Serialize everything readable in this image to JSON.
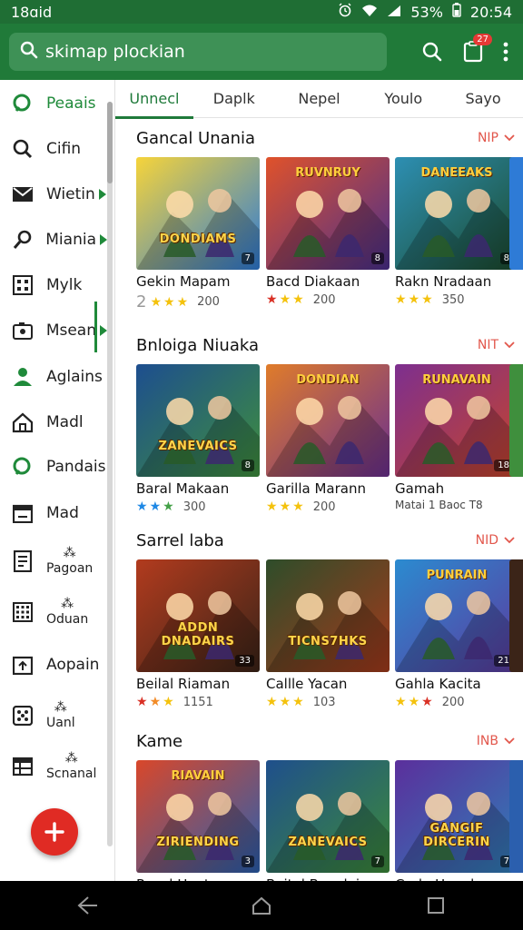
{
  "status_bar": {
    "left_text": "18ɑid",
    "battery": "53%",
    "time": "20:54"
  },
  "search": {
    "value": "skimap plockian",
    "cart_badge": "27"
  },
  "drawer": {
    "items": [
      {
        "label": "Peaais",
        "icon": "chat-bubble-icon",
        "active": true
      },
      {
        "label": "Cifin",
        "icon": "search-icon"
      },
      {
        "label": "Wietin",
        "icon": "mail-icon"
      },
      {
        "label": "Miania",
        "icon": "magnifier-icon"
      },
      {
        "label": "Mylk",
        "icon": "grid-icon"
      },
      {
        "label": "Msean",
        "icon": "camera-icon"
      },
      {
        "label": "Aglains",
        "icon": "person-icon"
      },
      {
        "label": "Madl",
        "icon": "home-icon"
      },
      {
        "label": "Pandais",
        "icon": "chat-bubble-icon"
      },
      {
        "label": "Mad",
        "icon": "calendar-icon"
      },
      {
        "label": "Pagoan",
        "icon": "document-icon",
        "top": "⁂"
      },
      {
        "label": "Oduan",
        "icon": "keypad-icon",
        "top": "⁂"
      },
      {
        "label": "Aopain",
        "icon": "upload-icon"
      },
      {
        "label": "Uanl",
        "icon": "dice-icon",
        "top": "⁂"
      },
      {
        "label": "Scnanal",
        "icon": "table-icon",
        "top": "⁂"
      }
    ]
  },
  "tabs": [
    {
      "label": "Unnecl",
      "active": true
    },
    {
      "label": "Daplk"
    },
    {
      "label": "Nepel"
    },
    {
      "label": "Youlo"
    },
    {
      "label": "Sayo"
    }
  ],
  "sections": [
    {
      "title": "Gancal Unania",
      "more": "NIP",
      "cards": [
        {
          "title": "Gekin Mapam",
          "cover": "DONDIAMS",
          "age": "7",
          "rating_num": "2",
          "count": "200",
          "stars": [
            "y",
            "y",
            "y"
          ],
          "colors": [
            "#f6d43a",
            "#2e7bd6"
          ]
        },
        {
          "title": "Bacd Diakaan",
          "cover_top": "RUVNRUY",
          "age": "8",
          "count": "200",
          "stars": [
            "r",
            "y",
            "y"
          ],
          "colors": [
            "#e0522a",
            "#4a2f8c"
          ]
        },
        {
          "title": "Rakn Nradaan",
          "cover_top": "DANEEAKS",
          "age": "8",
          "count": "350",
          "stars": [
            "y",
            "y",
            "y"
          ],
          "colors": [
            "#2d8fb3",
            "#1b4a2c"
          ]
        }
      ]
    },
    {
      "title": "Bnloiga Niuaka",
      "more": "NIT",
      "cards": [
        {
          "title": "Baral Makaan",
          "cover": "ZANEVAICS",
          "age": "8",
          "count": "300",
          "stars": [
            "b",
            "b",
            "g"
          ],
          "colors": [
            "#1d4e8f",
            "#3f8f3d"
          ]
        },
        {
          "title": "Garilla Marann",
          "cover_top": "DONDIAN",
          "count": "200",
          "stars": [
            "y",
            "y",
            "y"
          ],
          "colors": [
            "#e07c2a",
            "#6a2f8f"
          ]
        },
        {
          "title": "Gamah",
          "sub": "Matai 1 Baoc T8",
          "cover_top": "RUNAVAIN",
          "age": "18",
          "colors": [
            "#7d2f8f",
            "#c7452a"
          ]
        }
      ]
    },
    {
      "title": "Sarrel laba",
      "more": "NID",
      "cards": [
        {
          "title": "Beilal Riaman",
          "cover": "ADDN DNADAIRS",
          "age": "33",
          "count": "1151",
          "stars": [
            "r",
            "o",
            "y"
          ],
          "colors": [
            "#b23b1e",
            "#3b2418"
          ]
        },
        {
          "title": "Callle Yacan",
          "cover": "TICNS7HKS",
          "age": "",
          "count": "103",
          "stars": [
            "y",
            "y",
            "y"
          ],
          "colors": [
            "#2e4d2a",
            "#a33a1c"
          ]
        },
        {
          "title": "Gahla Kacita",
          "cover_top": "PUNRAIN",
          "age": "21",
          "count": "200",
          "stars": [
            "y",
            "y",
            "r"
          ],
          "colors": [
            "#2b8bd0",
            "#5c3a9e"
          ]
        }
      ]
    },
    {
      "title": "Kame",
      "more": "INB",
      "cards": [
        {
          "title": "Rasal Haata",
          "cover_top": "RIAVAIN",
          "cover": "ZIRIENDING",
          "age": "3",
          "colors": [
            "#d9472a",
            "#2b5fae"
          ]
        },
        {
          "title": "Baital Baaalaia",
          "cover": "ZANEVAICS",
          "age": "7",
          "colors": [
            "#1f4f8c",
            "#3c8a3a"
          ]
        },
        {
          "title": "Carla Hanala",
          "cover": "GANGIF DIRCERIN",
          "age": "7",
          "colors": [
            "#5b2f9c",
            "#2f7fb8"
          ]
        }
      ]
    }
  ]
}
